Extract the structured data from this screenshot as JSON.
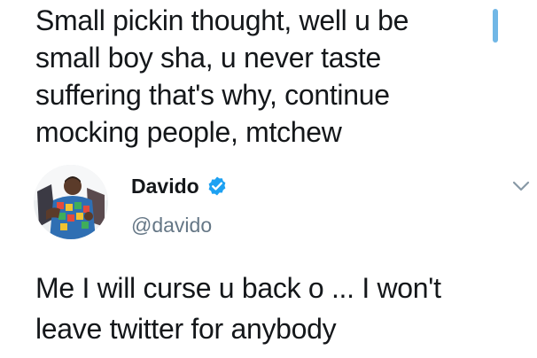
{
  "previous_tweet": {
    "text": "Small pickin thought, well u be\nsmall boy sha, u never taste\nsuffering that's why, continue\nmocking people, mtchew"
  },
  "reply_tweet": {
    "author": {
      "display_name": "Davido",
      "handle": "@davido",
      "verified": true,
      "avatar_icon": "avatar-photo"
    },
    "text": "Me I will curse u back o ... I won't\nleave twitter for anybody",
    "menu_icon": "chevron-down-icon"
  },
  "colors": {
    "text_primary": "#14171a",
    "text_secondary": "#657786",
    "accent_blue": "#1da1f2",
    "scroll_indicator": "#71b7e6"
  }
}
